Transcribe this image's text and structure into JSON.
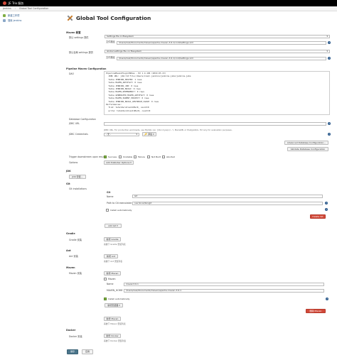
{
  "topbar": {
    "title": "JE Trio 服务"
  },
  "breadcrumb": {
    "item1": "jenkins",
    "item2": "Global Tool Configuration"
  },
  "sidebar": {
    "items": [
      {
        "label": "新建工作项"
      },
      {
        "label": "搜索 jenkins"
      }
    ]
  },
  "page": {
    "title": "Global Tool Configuration"
  },
  "maven_config": {
    "section": "Maven 配置",
    "default_settings_label": "默认 settings 提供",
    "default_settings_value": "Settings file in filesystem",
    "file_path_label": "文件路径",
    "file_path_value": "/Users/xiek/Documents/maven/apache-maven-3.6.1/conf/settings.xml",
    "global_settings_label": "默认全局 settings 提供",
    "global_settings_value": "Global settings file on filesystem",
    "global_file_path_label": "文件路径",
    "global_file_path_value": "/Users/xiek/Documents/maven/apache-maven-3.6.1/conf/settings.xml"
  },
  "pipeline_maven": {
    "section": "Pipeline Maven Configuration",
    "dao_label": "DAO",
    "dao_lines": [
      "PipelineMavenPluginH2Dao - H2 1.4.196 (2019-03-13)",
      "  JDBC URL: jdbc:h2:file:/Users/xiek/.jenkins/jenkins-jobs/jenkins-jobs",
      "  Table JENKINS_MASTER: 1 rows",
      "  Table MAVEN_ARTIFACT: 0 rows",
      "  Table JENKINS_JOB: 0 rows",
      "  Table JENKINS_BUILD: 0 rows",
      "  Table MAVEN_DEPENDENCY: 0 rows",
      "  Table GENERATED_MAVEN_ARTIFACT: 0 rows",
      "  Table MAVEN_PARENT_PROJECT: 0 rows",
      "  Table JENKINS_BUILD_UPSTREAM_CAUSE: 0 rows",
      "Performances:",
      "  find: totalDurationInMs=0, count=0",
      "  write: totalDurationInMs=0, count=0"
    ],
    "db_config_label": "Database Configuration",
    "jdbc_url_label": "JDBC URL",
    "jdbc_url_value": "",
    "jdbc_note": "JDBC URL. For production workloads, use MySQL (ex: 'jdbc:mysql://...'), MariaDB, or PostgreSQL. H2 only for evaluation purposes.",
    "jdbc_credentials_label": "JDBC Credentials",
    "jdbc_credentials_value": "- 无 -",
    "add_label": "添加",
    "advanced_db_button": "Advanced Database Configuration...",
    "validate_db_button": "Validate Database Configuration",
    "trigger_label": "Trigger downstream upon result",
    "results": [
      "Success",
      "Unstable",
      "Failure",
      "Not Built",
      "Aborted"
    ],
    "options_label": "Options",
    "add_publisher_button": "Add Publisher Options"
  },
  "jdk": {
    "section": "JDK",
    "add_button": "JDK 安装..."
  },
  "git": {
    "section": "Git",
    "installations_label": "Git installations",
    "git_label": "Git",
    "name_label": "Name",
    "name_value": "Git",
    "path_label": "Path to Git executable",
    "path_value": "/usr/local/bin/git",
    "install_auto_label": "Install automatically",
    "delete_button": "Delete Git",
    "add_git_button": "Add Git"
  },
  "gradle": {
    "section": "Gradle",
    "install_label": "Gradle 安装",
    "add_button": "新增 Gradle",
    "note": "系统下 Gradle 安装列表"
  },
  "ant": {
    "section": "Ant",
    "install_label": "Ant 安装",
    "add_button": "新增 Ant",
    "note": "系统下 Ant 安装列表"
  },
  "maven": {
    "section": "Maven",
    "install_label": "Maven 安装",
    "add_button": "新增 Maven",
    "maven_label": "Maven",
    "name_label": "Name",
    "name_value": "maven3.6.1",
    "home_label": "MAVEN_HOME",
    "home_value": "/Users/xiek/Documents/maven/apache-maven-3.6.1",
    "install_auto_label": "Install automatically",
    "add_installer": "新增安装器",
    "delete_button": "删除 Maven",
    "add_button2": "新增 Maven",
    "note": "系统下 Maven 安装列表"
  },
  "docker": {
    "section": "Docker",
    "install_label": "Docker 安装",
    "add_button": "新增 Docker",
    "note": "系统下 Docker 安装列表"
  },
  "footer": {
    "save_button": "保存",
    "apply_button": "应用"
  },
  "colors": {
    "jenkins_red": "#d24939",
    "link_blue": "#2b5a8c",
    "save_blue": "#4b758b",
    "success_green": "#7fae43"
  }
}
